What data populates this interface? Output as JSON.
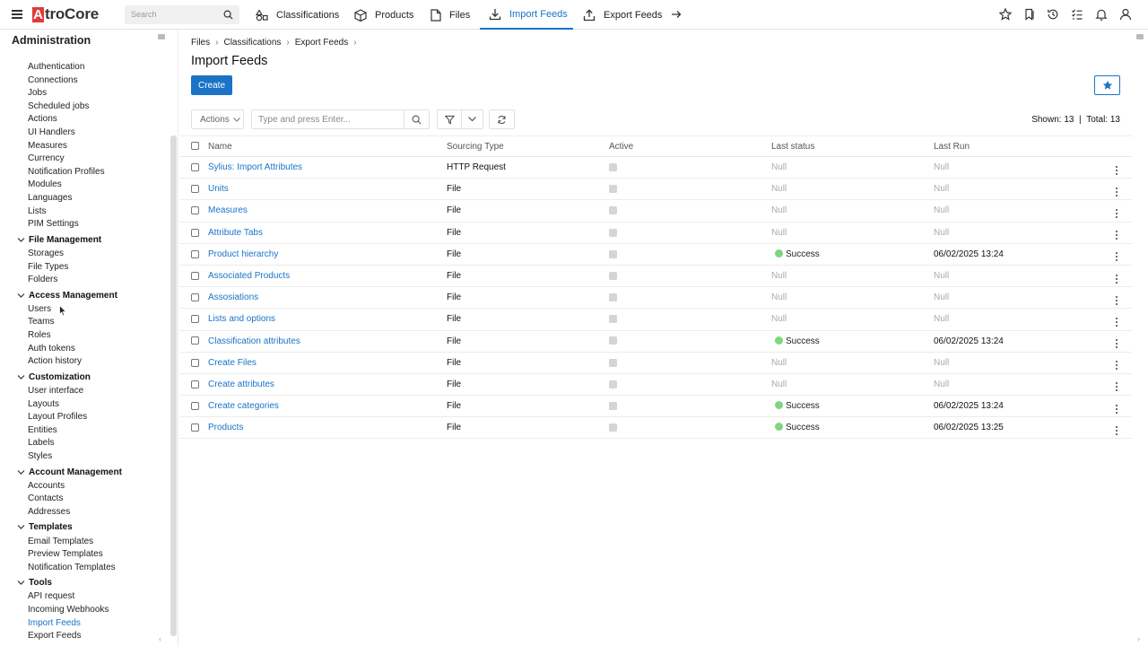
{
  "app": {
    "brand_initial": "A",
    "brand_rest": "troCore",
    "brand_color": "#e23a3a",
    "accent_color": "#1a73c7"
  },
  "topnav": {
    "search_placeholder": "Search",
    "tabs": [
      {
        "label": "Classifications",
        "icon": "classifications-icon",
        "active": false
      },
      {
        "label": "Products",
        "icon": "box-icon",
        "active": false
      },
      {
        "label": "Files",
        "icon": "file-icon",
        "active": false
      },
      {
        "label": "Import Feeds",
        "icon": "download-icon",
        "active": true
      },
      {
        "label": "Export Feeds",
        "icon": "upload-icon",
        "active": false
      }
    ],
    "right_icons": [
      "star-icon",
      "bookmarks-icon",
      "history-icon",
      "tasks-icon",
      "bell-icon",
      "user-icon"
    ]
  },
  "sidebar": {
    "title": "Administration",
    "top_items": [
      "Authentication",
      "Connections",
      "Jobs",
      "Scheduled jobs",
      "Actions",
      "UI Handlers",
      "Measures",
      "Currency",
      "Notification Profiles",
      "Modules",
      "Languages",
      "Lists",
      "PIM Settings"
    ],
    "groups": [
      {
        "label": "File Management",
        "items": [
          "Storages",
          "File Types",
          "Folders"
        ]
      },
      {
        "label": "Access Management",
        "items": [
          "Users",
          "Teams",
          "Roles",
          "Auth tokens",
          "Action history"
        ]
      },
      {
        "label": "Customization",
        "items": [
          "User interface",
          "Layouts",
          "Layout Profiles",
          "Entities",
          "Labels",
          "Styles"
        ]
      },
      {
        "label": "Account Management",
        "items": [
          "Accounts",
          "Contacts",
          "Addresses"
        ]
      },
      {
        "label": "Templates",
        "items": [
          "Email Templates",
          "Preview Templates",
          "Notification Templates"
        ]
      },
      {
        "label": "Tools",
        "items": [
          "API request",
          "Incoming Webhooks",
          "Import Feeds",
          "Export Feeds"
        ]
      }
    ],
    "active_item": "Import Feeds"
  },
  "main": {
    "breadcrumbs": [
      "Files",
      "Classifications",
      "Export Feeds"
    ],
    "title": "Import Feeds",
    "create_label": "Create",
    "actions_label": "Actions",
    "search_placeholder": "Type and press Enter...",
    "shown_label": "Shown: 13",
    "total_label": "Total: 13",
    "columns": [
      "Name",
      "Sourcing Type",
      "Active",
      "Last status",
      "Last Run"
    ],
    "rows": [
      {
        "name": "Sylius: Import Attributes",
        "type": "HTTP Request",
        "status": "Null",
        "run": "Null"
      },
      {
        "name": "Units",
        "type": "File",
        "status": "Null",
        "run": "Null"
      },
      {
        "name": "Measures",
        "type": "File",
        "status": "Null",
        "run": "Null"
      },
      {
        "name": "Attribute Tabs",
        "type": "File",
        "status": "Null",
        "run": "Null"
      },
      {
        "name": "Product hierarchy",
        "type": "File",
        "status": "Success",
        "run": "06/02/2025 13:24"
      },
      {
        "name": "Associated Products",
        "type": "File",
        "status": "Null",
        "run": "Null"
      },
      {
        "name": "Assosiations",
        "type": "File",
        "status": "Null",
        "run": "Null"
      },
      {
        "name": "Lists and options",
        "type": "File",
        "status": "Null",
        "run": "Null"
      },
      {
        "name": "Classification attributes",
        "type": "File",
        "status": "Success",
        "run": "06/02/2025 13:24"
      },
      {
        "name": "Create Files",
        "type": "File",
        "status": "Null",
        "run": "Null"
      },
      {
        "name": "Create attributes",
        "type": "File",
        "status": "Null",
        "run": "Null"
      },
      {
        "name": "Create categories",
        "type": "File",
        "status": "Success",
        "run": "06/02/2025 13:24"
      },
      {
        "name": "Products",
        "type": "File",
        "status": "Success",
        "run": "06/02/2025 13:25"
      }
    ],
    "success_color": "#7ed67e"
  }
}
